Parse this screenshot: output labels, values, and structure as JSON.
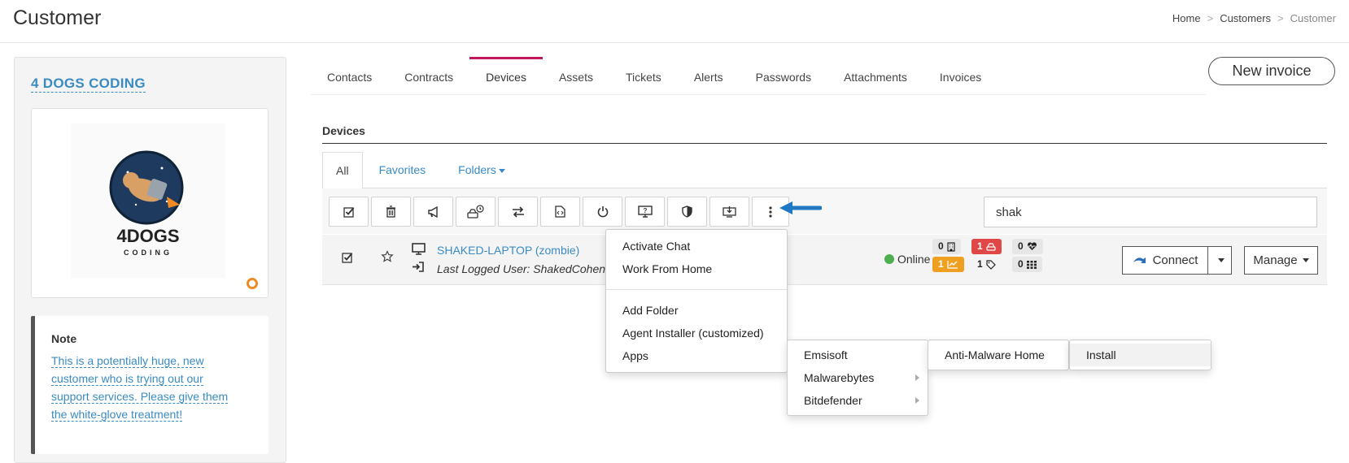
{
  "header": {
    "title": "Customer",
    "breadcrumb": [
      {
        "label": "Home"
      },
      {
        "label": "Customers"
      },
      {
        "label": "Customer"
      }
    ],
    "separator": ">"
  },
  "sidebar": {
    "company_name": "4 DOGS CODING",
    "logo_text": "4DOGS",
    "logo_subtext": "CODING",
    "note_title": "Note",
    "note_text": "This is a potentially huge, new customer who is trying out our support services. Please give them the white-glove treatment!"
  },
  "tabs": [
    {
      "label": "Contacts"
    },
    {
      "label": "Contracts"
    },
    {
      "label": "Devices",
      "active": true
    },
    {
      "label": "Assets"
    },
    {
      "label": "Tickets"
    },
    {
      "label": "Alerts"
    },
    {
      "label": "Passwords"
    },
    {
      "label": "Attachments"
    },
    {
      "label": "Invoices"
    }
  ],
  "new_invoice_label": "New invoice",
  "devices_heading": "Devices",
  "subtabs": {
    "all": "All",
    "favorites": "Favorites",
    "folders": "Folders"
  },
  "toolbar_icons": [
    "select-all-icon",
    "trash-icon",
    "megaphone-icon",
    "disk-schedule-icon",
    "transfer-icon",
    "script-icon",
    "power-icon",
    "remote-help-icon",
    "shield-icon",
    "download-install-icon",
    "more-dots-icon"
  ],
  "search": {
    "value": "shak"
  },
  "device": {
    "name": "SHAKED-LAPTOP (zombie)",
    "last_user": "Last Logged User: ShakedCohen",
    "status": "Online",
    "status_color": "#4caf50",
    "badges": {
      "servers": "0",
      "storage_alerts": "1",
      "health": "0",
      "performance": "1",
      "tags": "1",
      "apps": "0"
    },
    "connect_label": "Connect",
    "manage_label": "Manage"
  },
  "menu": {
    "items_top": [
      "Activate Chat",
      "Work From Home"
    ],
    "items_bottom": [
      "Add Folder",
      "Agent Installer (customized)",
      "Apps"
    ],
    "apps_submenu": [
      "Emsisoft",
      "Malwarebytes",
      "Bitdefender"
    ],
    "emsisoft_submenu": [
      "Anti-Malware Home"
    ],
    "product_submenu": [
      "Install"
    ]
  },
  "colors": {
    "accent_link": "#3a8bc2",
    "active_tab": "#c2185b",
    "badge_red": "#e04848",
    "badge_orange": "#f0a020",
    "arrow_blue": "#1f78c1"
  }
}
